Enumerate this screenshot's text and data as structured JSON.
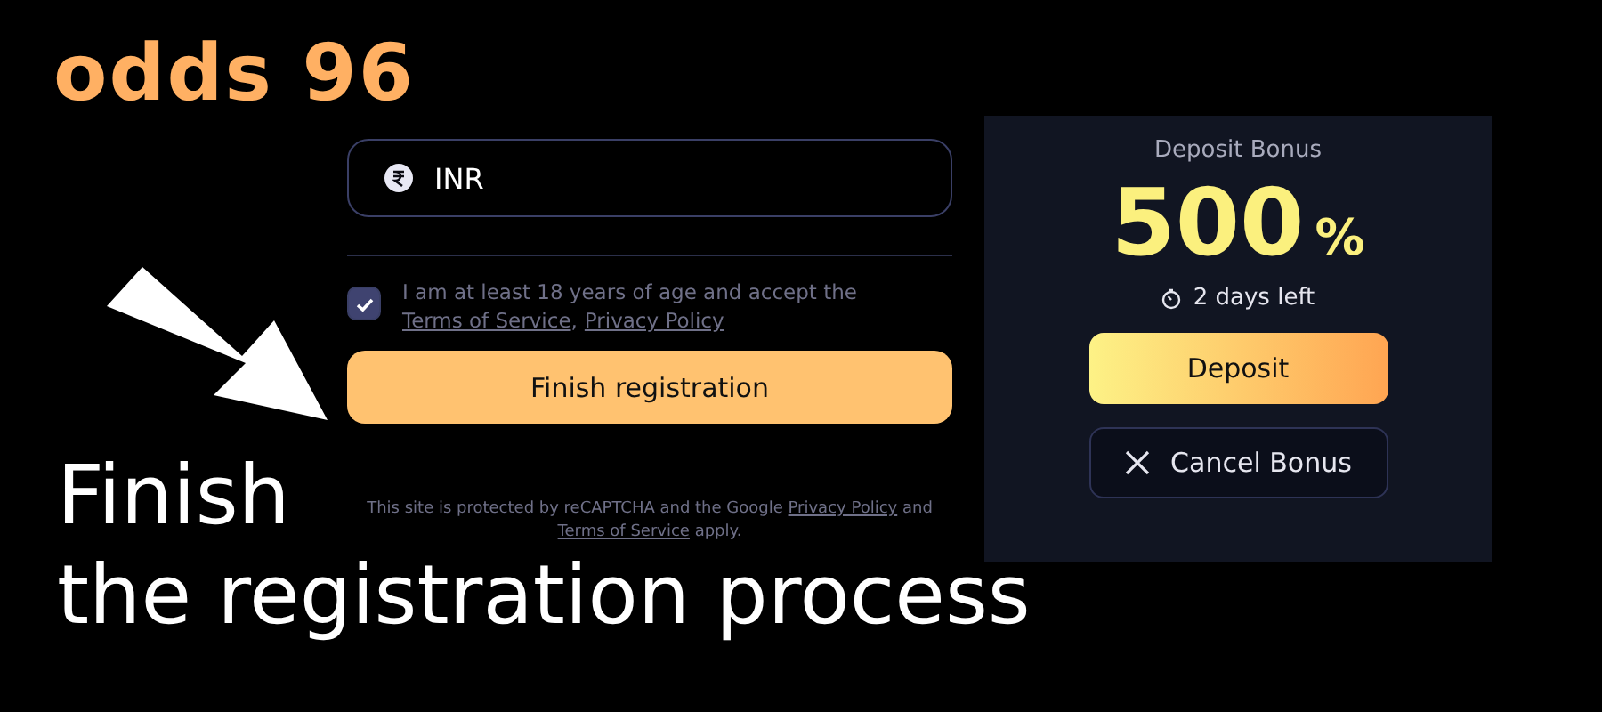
{
  "logo": "odds 96",
  "form": {
    "currency_field": {
      "value": "INR"
    },
    "consent": {
      "checked": true,
      "text": "I am at least 18 years of age and accept the",
      "links": [
        "Terms of Service",
        "Privacy Policy"
      ],
      "separator": ","
    },
    "submit": "Finish registration",
    "recaptcha": {
      "before": "This site is protected by reCAPTCHA and the Google",
      "link1": "Privacy Policy",
      "middle": "and",
      "link2": "Terms of Service",
      "after": "apply."
    }
  },
  "bonus": {
    "title": "Deposit Bonus",
    "amount": "500",
    "unit": "%",
    "time_left": "2 days left",
    "deposit": "Deposit",
    "cancel": "Cancel Bonus"
  },
  "headline": [
    "Finish",
    "the registration process"
  ]
}
